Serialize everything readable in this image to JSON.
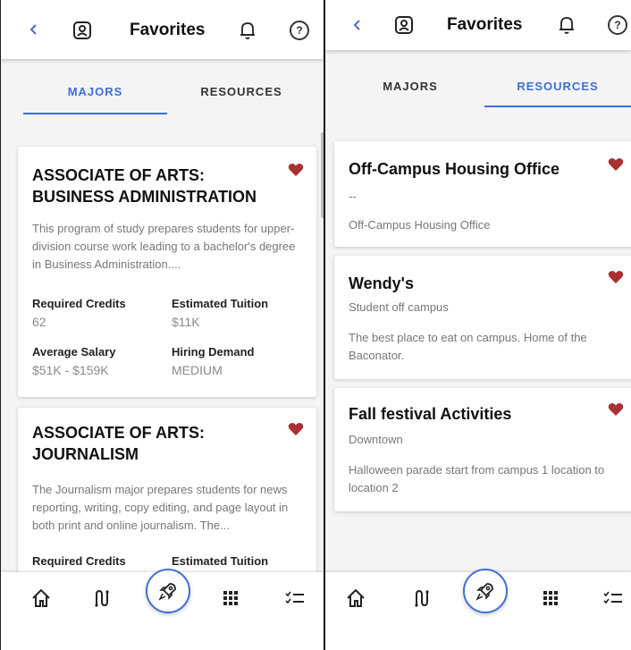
{
  "colors": {
    "accent": "#3f6fd8",
    "heart": "#a83232",
    "muted": "#777777"
  },
  "left_screen": {
    "header": {
      "title": "Favorites",
      "back_icon": "chevron-left-icon",
      "profile_icon": "profile-icon",
      "bell_icon": "bell-icon",
      "help_label": "?"
    },
    "tabs": [
      {
        "label": "MAJORS",
        "active": true
      },
      {
        "label": "RESOURCES",
        "active": false
      }
    ],
    "cards": [
      {
        "title": "ASSOCIATE OF ARTS: BUSINESS ADMINISTRATION",
        "description": "This program of study prepares students for upper-division course work leading to a bachelor's degree in Business Administration....",
        "stats": [
          {
            "label": "Required Credits",
            "value": "62"
          },
          {
            "label": "Estimated Tuition",
            "value": "$11K"
          },
          {
            "label": "Average Salary",
            "value": "$51K - $159K"
          },
          {
            "label": "Hiring Demand",
            "value": "MEDIUM"
          }
        ]
      },
      {
        "title": "ASSOCIATE OF ARTS: JOURNALISM",
        "description": "The Journalism major prepares students for news reporting, writing, copy editing, and page layout in both print and online journalism. The...",
        "stats": [
          {
            "label": "Required Credits",
            "value": ""
          },
          {
            "label": "Estimated Tuition",
            "value": ""
          }
        ]
      }
    ]
  },
  "right_screen": {
    "header": {
      "title": "Favorites",
      "back_icon": "chevron-left-icon",
      "profile_icon": "profile-icon",
      "bell_icon": "bell-icon",
      "help_label": "?"
    },
    "tabs": [
      {
        "label": "MAJORS",
        "active": false
      },
      {
        "label": "RESOURCES",
        "active": true
      }
    ],
    "resources": [
      {
        "title": "Off-Campus Housing Office",
        "subtitle": "--",
        "description": "Off-Campus Housing Office"
      },
      {
        "title": "Wendy's",
        "subtitle": "Student off campus",
        "description": "The best place to eat on campus. Home of the Baconator."
      },
      {
        "title": "Fall festival Activities",
        "subtitle": "Downtown",
        "description": "Halloween parade start from campus 1 location to location 2"
      }
    ]
  },
  "bottom_nav": {
    "items": [
      "home-icon",
      "route-icon",
      "rocket-icon",
      "grid-icon",
      "checklist-icon"
    ]
  }
}
